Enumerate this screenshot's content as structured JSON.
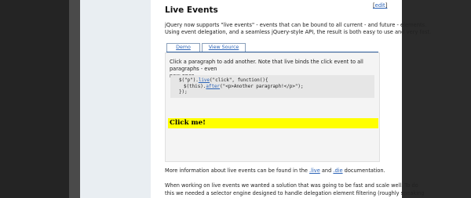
{
  "article": {
    "edit_label": "edit",
    "edit_bracket_open": "[",
    "edit_bracket_close": "]",
    "title": "Live Events",
    "intro_line1": "jQuery now supports \"live events\" - events that can be bound to all current - and future - elements.",
    "intro_line2": "Using event delegation, and a seamless jQuery-style API, the result is both easy to use and very fast.",
    "tabs": [
      {
        "label": "Demo"
      },
      {
        "label": "View Source"
      }
    ],
    "demo": {
      "description_line1": "Click a paragraph to add another. Note that live binds the click event to all paragraphs - even",
      "description_line2": "new ones.",
      "code": {
        "l1_pre": "$(\"p\").",
        "l1_fn": "live",
        "l1_post": "(\"click\", function(){",
        "l2_pre": "$(this).",
        "l2_fn": "after",
        "l2_post": "(\"<p>Another paragraph!</p>\");",
        "l3": "});"
      },
      "click_me": "Click me!"
    },
    "more_info": {
      "pre": "More information about live events can be found in the ",
      "link1": ".live",
      "mid": " and ",
      "link2": ".die",
      "post": " documentation."
    },
    "para2_line1": "When working on live events we wanted a solution that was going to be fast and scale well. To do",
    "para2_line2": "this we needed a selector engine designed to handle delegation element filtering (roughly speaking"
  },
  "colors": {
    "link": "#2b63b7",
    "highlight": "#ffff00",
    "code_bg": "#e6e6e6"
  }
}
